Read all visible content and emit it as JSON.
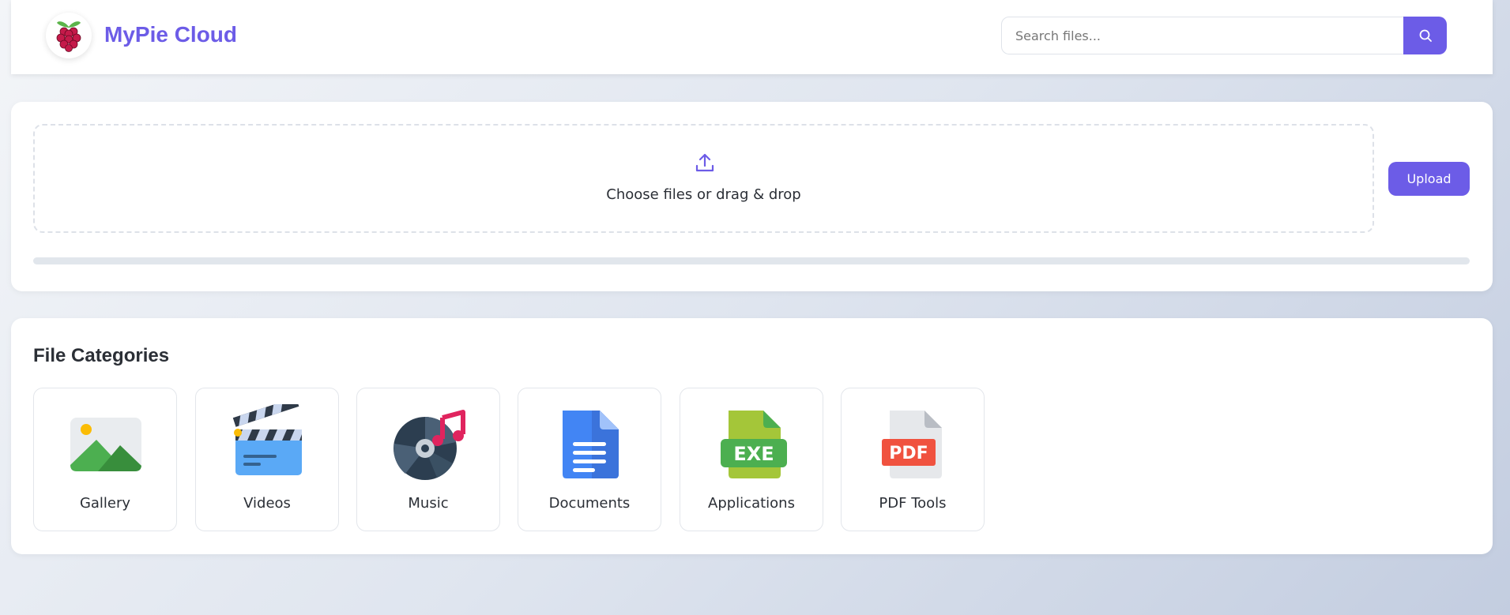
{
  "header": {
    "brand": "MyPie Cloud",
    "logo_icon": "raspberry-icon",
    "search": {
      "placeholder": "Search files...",
      "value": "",
      "icon": "search-icon"
    }
  },
  "upload": {
    "icon": "upload-icon",
    "dropzone_label": "Choose files or drag & drop",
    "button_label": "Upload",
    "progress_fraction": 0
  },
  "categories": {
    "title": "File Categories",
    "items": [
      {
        "label": "Gallery",
        "icon": "image-icon"
      },
      {
        "label": "Videos",
        "icon": "clapperboard-icon"
      },
      {
        "label": "Music",
        "icon": "music-disc-icon"
      },
      {
        "label": "Documents",
        "icon": "document-icon"
      },
      {
        "label": "Applications",
        "icon": "exe-file-icon",
        "badge": "EXE"
      },
      {
        "label": "PDF Tools",
        "icon": "pdf-file-icon",
        "badge": "PDF"
      }
    ]
  },
  "colors": {
    "accent": "#6c5ce7",
    "text": "#2b2f36",
    "border": "#e3e6eb"
  }
}
